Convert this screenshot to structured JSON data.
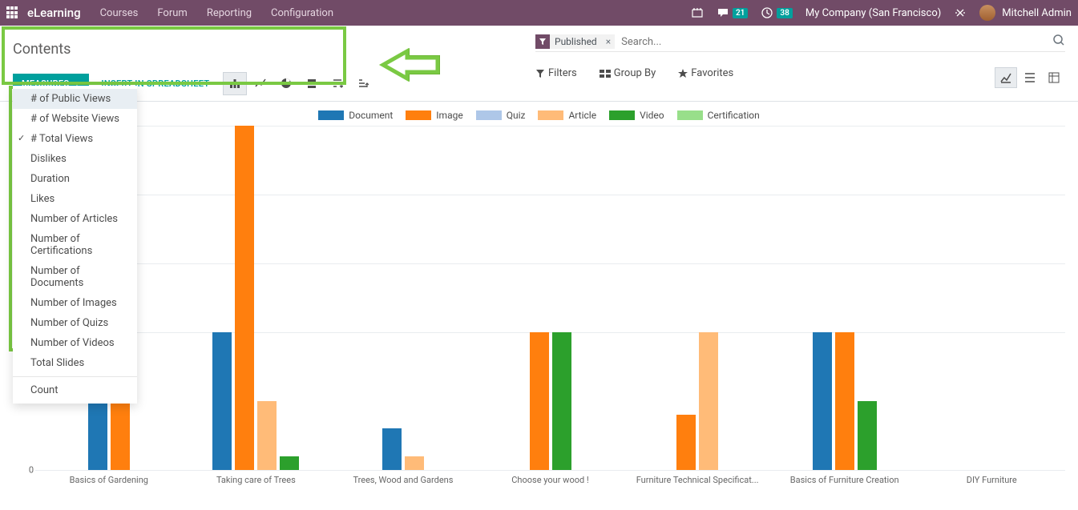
{
  "topnav": {
    "brand": "eLearning",
    "links": [
      "Courses",
      "Forum",
      "Reporting",
      "Configuration"
    ],
    "chat_badge": "21",
    "activity_badge": "38",
    "company": "My Company (San Francisco)",
    "user": "Mitchell Admin"
  },
  "cp": {
    "title": "Contents",
    "search_placeholder": "Search...",
    "facet_label": "Published",
    "measures_btn": "MEASURES",
    "insert_btn": "INSERT IN SPREADSHEET",
    "filters": "Filters",
    "groupby": "Group By",
    "favorites": "Favorites"
  },
  "measures_menu": {
    "items": [
      {
        "label": "# of Public Views",
        "checked": false,
        "hover": true
      },
      {
        "label": "# of Website Views",
        "checked": false
      },
      {
        "label": "# Total Views",
        "checked": true
      },
      {
        "label": "Dislikes",
        "checked": false
      },
      {
        "label": "Duration",
        "checked": false
      },
      {
        "label": "Likes",
        "checked": false
      },
      {
        "label": "Number of Articles",
        "checked": false
      },
      {
        "label": "Number of Certifications",
        "checked": false
      },
      {
        "label": "Number of Documents",
        "checked": false
      },
      {
        "label": "Number of Images",
        "checked": false
      },
      {
        "label": "Number of Quizs",
        "checked": false
      },
      {
        "label": "Number of Videos",
        "checked": false
      },
      {
        "label": "Total Slides",
        "checked": false
      }
    ],
    "count_label": "Count"
  },
  "chart_data": {
    "type": "bar",
    "title": "",
    "ylabel": "",
    "ylim": [
      0,
      2.5
    ],
    "yticks": [
      0,
      5,
      1,
      1.5,
      2,
      2.5
    ],
    "yticks_display": [
      "0",
      "5",
      "1",
      "1",
      "2",
      "2"
    ],
    "categories": [
      "Basics of Gardening",
      "Taking care of Trees",
      "Trees, Wood and Gardens",
      "Choose your wood !",
      "Furniture Technical Specificat...",
      "Basics of Furniture Creation",
      "DIY Furniture"
    ],
    "series": [
      {
        "name": "Document",
        "color": "#1f77b4",
        "class": "c-document",
        "values": [
          0.8,
          1,
          0.3,
          null,
          null,
          1,
          null
        ]
      },
      {
        "name": "Image",
        "color": "#ff7f0e",
        "class": "c-image",
        "values": [
          0.8,
          2.5,
          null,
          1,
          0.4,
          1,
          null
        ]
      },
      {
        "name": "Quiz",
        "color": "#aec7e8",
        "class": "c-quiz",
        "values": [
          null,
          null,
          null,
          null,
          null,
          null,
          null
        ]
      },
      {
        "name": "Article",
        "color": "#ffbb78",
        "class": "c-article",
        "values": [
          null,
          0.5,
          0.1,
          null,
          1,
          null,
          null
        ]
      },
      {
        "name": "Video",
        "color": "#2ca02c",
        "class": "c-video",
        "values": [
          null,
          0.1,
          null,
          1,
          null,
          0.5,
          null
        ]
      },
      {
        "name": "Certification",
        "color": "#98df8a",
        "class": "c-certification",
        "values": [
          null,
          null,
          null,
          null,
          null,
          null,
          null
        ]
      }
    ]
  }
}
